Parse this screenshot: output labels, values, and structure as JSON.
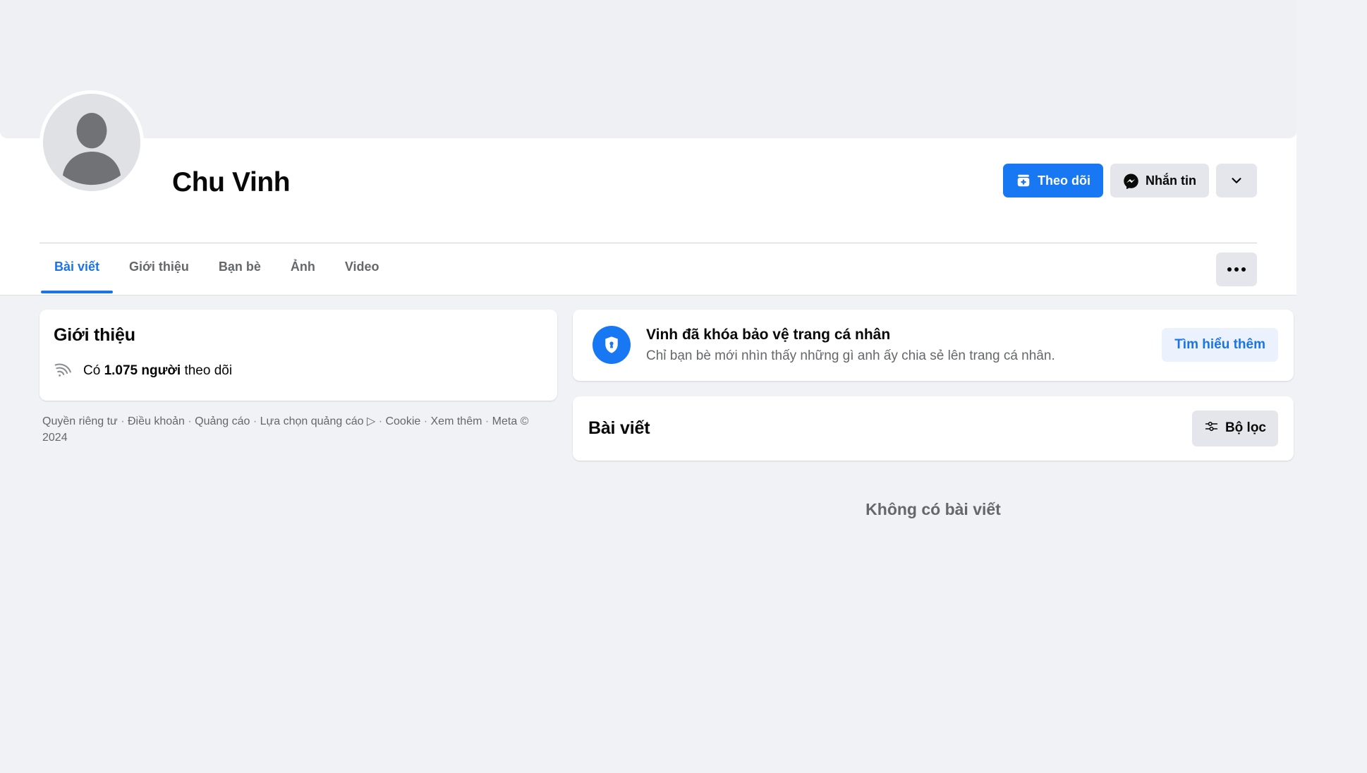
{
  "profile": {
    "name": "Chu Vinh",
    "avatar_icon": "default-user-avatar-icon",
    "cover_placeholder": true
  },
  "header_actions": {
    "follow": {
      "label": "Theo dõi",
      "icon": "follow-plus-icon",
      "color": "#1877f2"
    },
    "message": {
      "label": "Nhắn tin",
      "icon": "messenger-icon"
    },
    "more_dropdown": {
      "icon": "chevron-down-icon"
    }
  },
  "tabs": {
    "items": [
      {
        "label": "Bài viết",
        "active": true
      },
      {
        "label": "Giới thiệu",
        "active": false
      },
      {
        "label": "Bạn bè",
        "active": false
      },
      {
        "label": "Ảnh",
        "active": false
      },
      {
        "label": "Video",
        "active": false
      }
    ],
    "more_icon": "ellipsis-icon",
    "active_color": "#1b74e4"
  },
  "intro": {
    "title": "Giới thiệu",
    "follower_icon": "rss-followers-icon",
    "followers_prefix": "Có ",
    "followers_count": "1.075 người",
    "followers_suffix": " theo dõi"
  },
  "footer": {
    "links": [
      "Quyền riêng tư",
      "Điều khoản",
      "Quảng cáo",
      "Lựa chọn quảng cáo",
      "Cookie",
      "Xem thêm"
    ],
    "ad_choices_icon": "ad-choices-icon",
    "copyright": "Meta © 2024"
  },
  "lock_notice": {
    "icon": "shield-lock-icon",
    "icon_color": "#1877f2",
    "title": "Vinh đã khóa bảo vệ trang cá nhân",
    "description": "Chỉ bạn bè mới nhìn thấy những gì anh ấy chia sẻ lên trang cá nhân.",
    "action_label": "Tìm hiểu thêm",
    "action_color": "#1b74e4"
  },
  "posts": {
    "title": "Bài viết",
    "filter_label": "Bộ lọc",
    "filter_icon": "tune-sliders-icon",
    "empty_message": "Không có bài viết"
  }
}
